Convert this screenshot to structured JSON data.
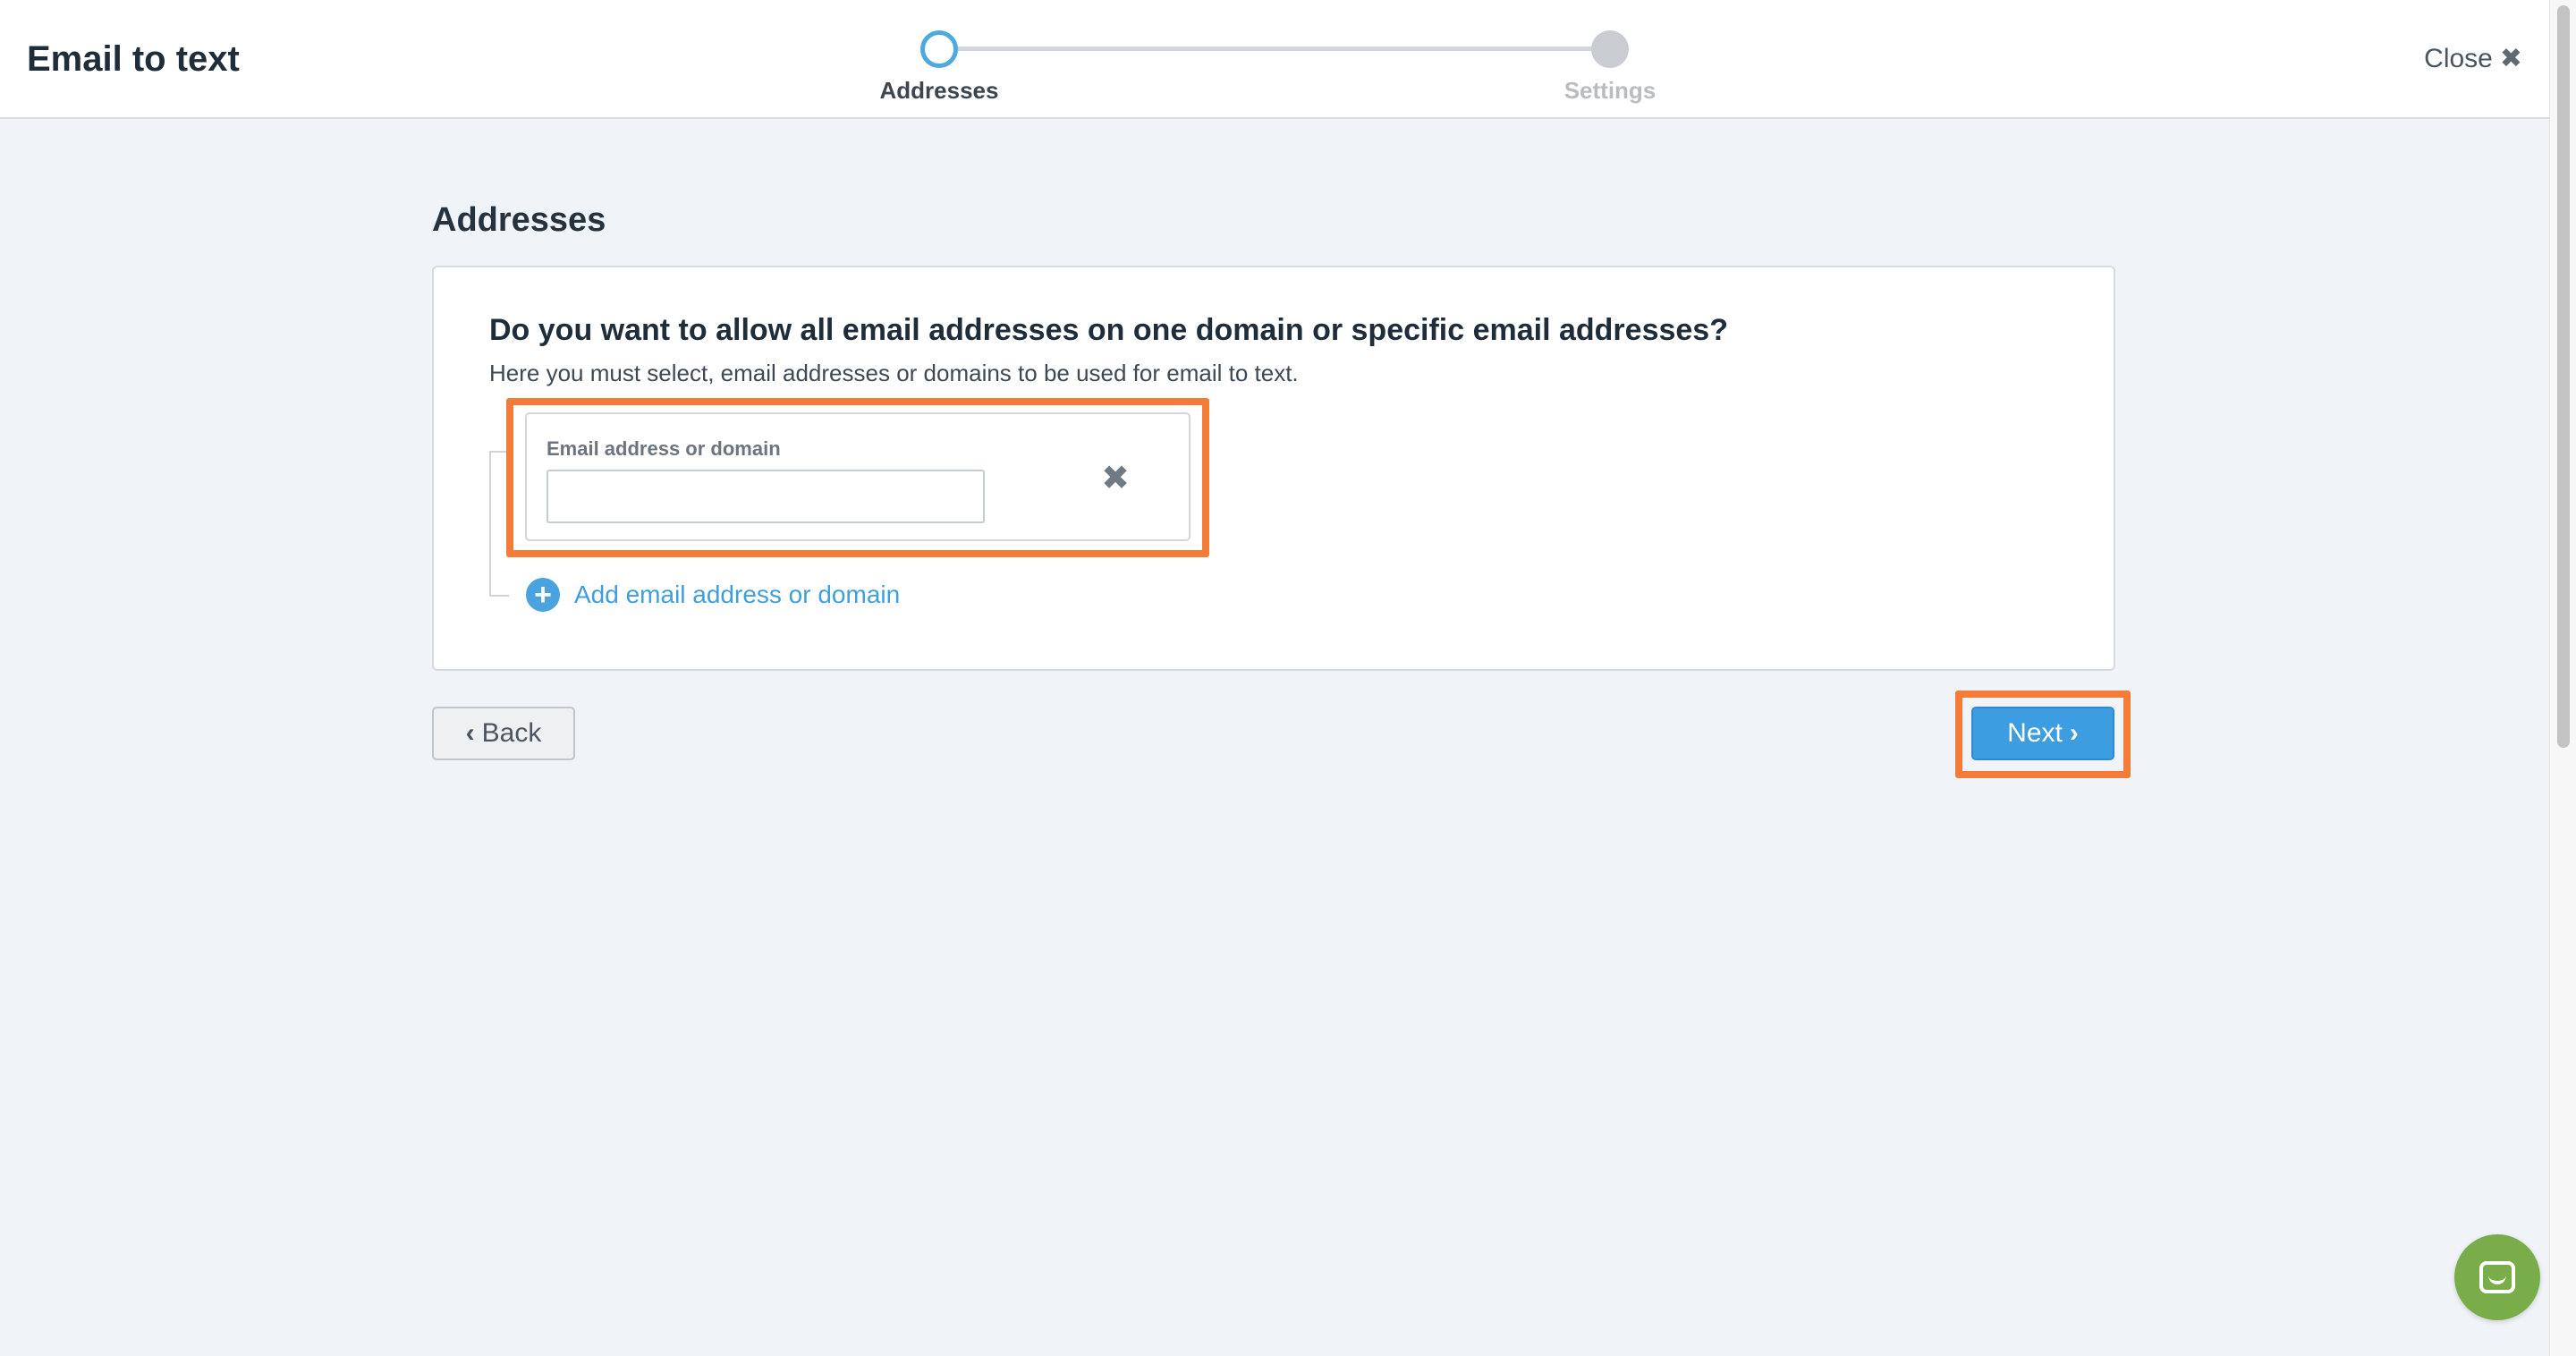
{
  "header": {
    "title": "Email to text",
    "close_label": "Close",
    "close_icon": "close-x-icon"
  },
  "stepper": {
    "steps": [
      {
        "label": "Addresses",
        "state": "active"
      },
      {
        "label": "Settings",
        "state": "inactive"
      }
    ]
  },
  "main": {
    "section_title": "Addresses",
    "question": "Do you want to allow all email addresses on one domain or specific email addresses?",
    "help_text": "Here you must select, email addresses or domains to be used for email to text.",
    "entry": {
      "label": "Email address or domain",
      "value": "",
      "placeholder": ""
    },
    "add_link_label": "Add email address or domain"
  },
  "footer": {
    "back_label": "Back",
    "next_label": "Next"
  },
  "colors": {
    "accent_blue": "#3d9de1",
    "highlight_orange": "#f57b39",
    "chat_green": "#79ad4a"
  }
}
